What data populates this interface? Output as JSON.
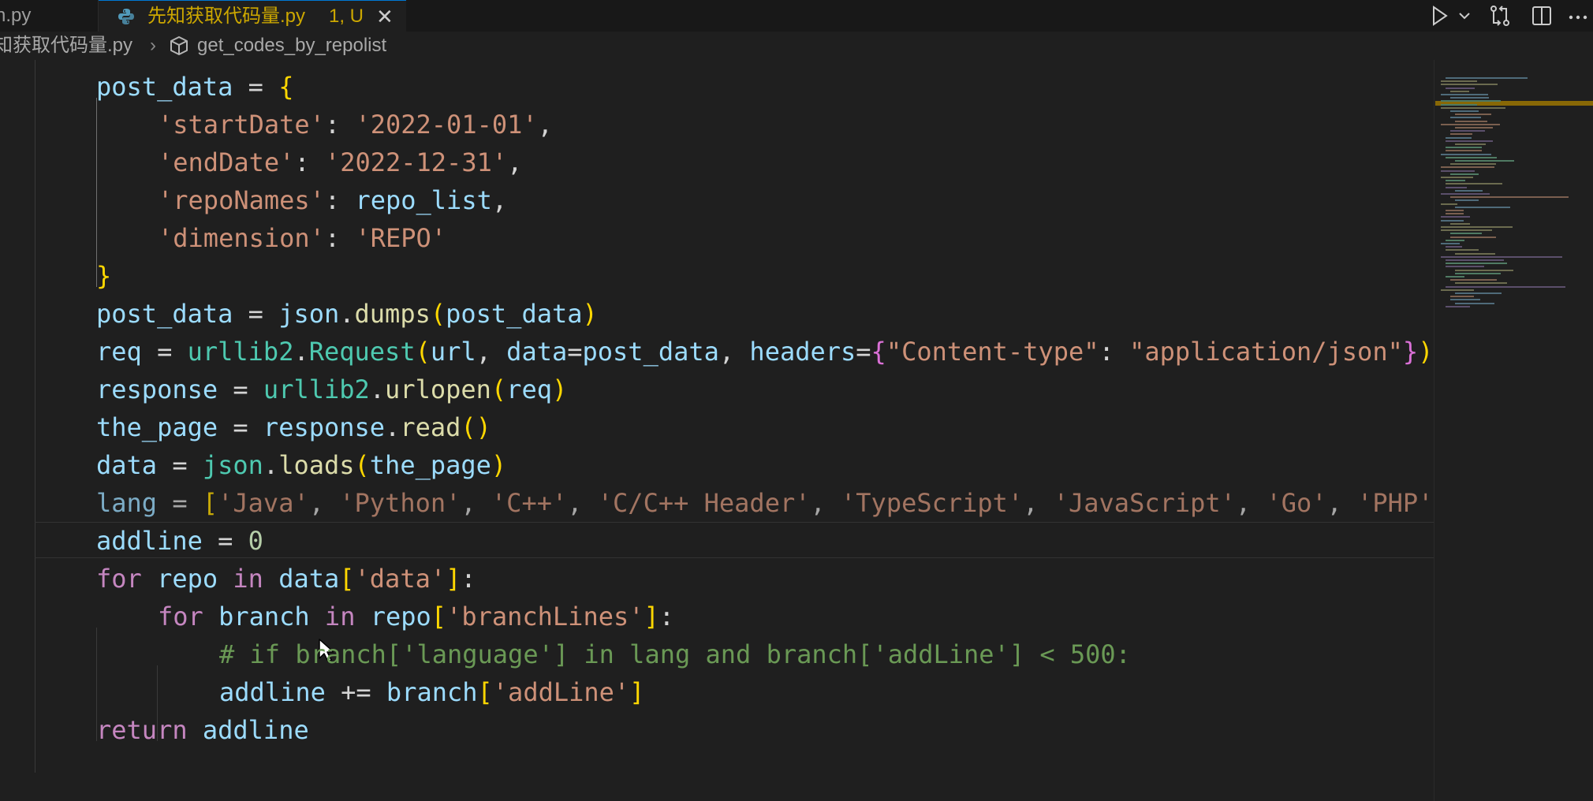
{
  "tabs": {
    "previous": {
      "label": "n.py"
    },
    "active": {
      "label": "先知获取代码量.py",
      "status": "1, U",
      "icon": "python-icon"
    }
  },
  "toolbar": {
    "run_icon": "play-icon",
    "run_dropdown_icon": "chevron-down-icon",
    "compare_icon": "git-compare-icon",
    "split_icon": "split-editor-icon",
    "more_icon": "ellipsis-icon"
  },
  "breadcrumb": {
    "file": "知获取代码量.py",
    "separator": "›",
    "symbol_icon": "cube-icon",
    "symbol": "get_codes_by_repolist"
  },
  "colors": {
    "accent": "#0078d4",
    "modified_tab": "#cca700",
    "keyword": "#c586c0",
    "string": "#ce9178",
    "variable": "#9cdcfe",
    "function": "#dcdcaa",
    "comment": "#6a9955"
  },
  "code": {
    "lines": [
      {
        "indent": 1,
        "tokens": [
          [
            "v",
            "post_data"
          ],
          [
            "o",
            " = "
          ],
          [
            "b1",
            "{"
          ]
        ]
      },
      {
        "indent": 2,
        "tokens": [
          [
            "s",
            "'startDate'"
          ],
          [
            "o",
            ": "
          ],
          [
            "s",
            "'2022-01-01'"
          ],
          [
            "o",
            ","
          ]
        ]
      },
      {
        "indent": 2,
        "tokens": [
          [
            "s",
            "'endDate'"
          ],
          [
            "o",
            ": "
          ],
          [
            "s",
            "'2022-12-31'"
          ],
          [
            "o",
            ","
          ]
        ]
      },
      {
        "indent": 2,
        "tokens": [
          [
            "s",
            "'repoNames'"
          ],
          [
            "o",
            ": "
          ],
          [
            "v",
            "repo_list"
          ],
          [
            "o",
            ","
          ]
        ]
      },
      {
        "indent": 2,
        "tokens": [
          [
            "s",
            "'dimension'"
          ],
          [
            "o",
            ": "
          ],
          [
            "s",
            "'REPO'"
          ]
        ]
      },
      {
        "indent": 1,
        "tokens": [
          [
            "b1",
            "}"
          ]
        ]
      },
      {
        "indent": 1,
        "tokens": [
          [
            "v",
            "post_data"
          ],
          [
            "o",
            " = "
          ],
          [
            "v",
            "json"
          ],
          [
            "o",
            "."
          ],
          [
            "f",
            "dumps"
          ],
          [
            "b1",
            "("
          ],
          [
            "v",
            "post_data"
          ],
          [
            "b1",
            ")"
          ]
        ]
      },
      {
        "indent": 1,
        "tokens": [
          [
            "v",
            "req"
          ],
          [
            "o",
            " = "
          ],
          [
            "t",
            "urllib2"
          ],
          [
            "o",
            "."
          ],
          [
            "t",
            "Request"
          ],
          [
            "b1",
            "("
          ],
          [
            "v",
            "url"
          ],
          [
            "o",
            ", "
          ],
          [
            "v",
            "data"
          ],
          [
            "o",
            "="
          ],
          [
            "v",
            "post_data"
          ],
          [
            "o",
            ", "
          ],
          [
            "v",
            "headers"
          ],
          [
            "o",
            "="
          ],
          [
            "b2",
            "{"
          ],
          [
            "s",
            "\"Content-type\""
          ],
          [
            "o",
            ": "
          ],
          [
            "s",
            "\"application/json\""
          ],
          [
            "b2",
            "}"
          ],
          [
            "b1",
            ")"
          ]
        ]
      },
      {
        "indent": 1,
        "tokens": [
          [
            "v",
            "response"
          ],
          [
            "o",
            " = "
          ],
          [
            "t",
            "urllib2"
          ],
          [
            "o",
            "."
          ],
          [
            "f",
            "urlopen"
          ],
          [
            "b1",
            "("
          ],
          [
            "v",
            "req"
          ],
          [
            "b1",
            ")"
          ]
        ]
      },
      {
        "indent": 1,
        "tokens": [
          [
            "v",
            "the_page"
          ],
          [
            "o",
            " = "
          ],
          [
            "v",
            "response"
          ],
          [
            "o",
            "."
          ],
          [
            "f",
            "read"
          ],
          [
            "b1",
            "()"
          ]
        ]
      },
      {
        "indent": 1,
        "tokens": [
          [
            "v",
            "data"
          ],
          [
            "o",
            " = "
          ],
          [
            "t",
            "json"
          ],
          [
            "o",
            "."
          ],
          [
            "f",
            "loads"
          ],
          [
            "b1",
            "("
          ],
          [
            "v",
            "the_page"
          ],
          [
            "b1",
            ")"
          ]
        ]
      },
      {
        "indent": 1,
        "dim": true,
        "tokens": [
          [
            "v",
            "lang"
          ],
          [
            "o",
            " = "
          ],
          [
            "b1",
            "["
          ],
          [
            "s",
            "'Java'"
          ],
          [
            "o",
            ", "
          ],
          [
            "s",
            "'Python'"
          ],
          [
            "o",
            ", "
          ],
          [
            "s",
            "'C++'"
          ],
          [
            "o",
            ", "
          ],
          [
            "s",
            "'C/C++ Header'"
          ],
          [
            "o",
            ", "
          ],
          [
            "s",
            "'TypeScript'"
          ],
          [
            "o",
            ", "
          ],
          [
            "s",
            "'JavaScript'"
          ],
          [
            "o",
            ", "
          ],
          [
            "s",
            "'Go'"
          ],
          [
            "o",
            ", "
          ],
          [
            "s",
            "'PHP'"
          ],
          [
            "b1",
            "]"
          ]
        ]
      },
      {
        "indent": 1,
        "current": true,
        "tokens": [
          [
            "v",
            "addline"
          ],
          [
            "o",
            " = "
          ],
          [
            "n",
            "0"
          ]
        ]
      },
      {
        "indent": 1,
        "tokens": [
          [
            "k",
            "for"
          ],
          [
            "o",
            " "
          ],
          [
            "v",
            "repo"
          ],
          [
            "o",
            " "
          ],
          [
            "k",
            "in"
          ],
          [
            "o",
            " "
          ],
          [
            "v",
            "data"
          ],
          [
            "b1",
            "["
          ],
          [
            "s",
            "'data'"
          ],
          [
            "b1",
            "]"
          ],
          [
            "o",
            ":"
          ]
        ]
      },
      {
        "indent": 2,
        "tokens": [
          [
            "k",
            "for"
          ],
          [
            "o",
            " "
          ],
          [
            "v",
            "branch"
          ],
          [
            "o",
            " "
          ],
          [
            "k",
            "in"
          ],
          [
            "o",
            " "
          ],
          [
            "v",
            "repo"
          ],
          [
            "b1",
            "["
          ],
          [
            "s",
            "'branchLines'"
          ],
          [
            "b1",
            "]"
          ],
          [
            "o",
            ":"
          ]
        ]
      },
      {
        "indent": 3,
        "tokens": [
          [
            "c",
            "# if branch['language'] in lang and branch['addLine'] < 500:"
          ]
        ]
      },
      {
        "indent": 3,
        "tokens": [
          [
            "v",
            "addline"
          ],
          [
            "o",
            " += "
          ],
          [
            "v",
            "branch"
          ],
          [
            "b1",
            "["
          ],
          [
            "s",
            "'addLine'"
          ],
          [
            "b1",
            "]"
          ]
        ]
      },
      {
        "indent": 1,
        "tokens": [
          [
            "k",
            "return"
          ],
          [
            "o",
            " "
          ],
          [
            "v",
            "addline"
          ]
        ]
      }
    ]
  }
}
